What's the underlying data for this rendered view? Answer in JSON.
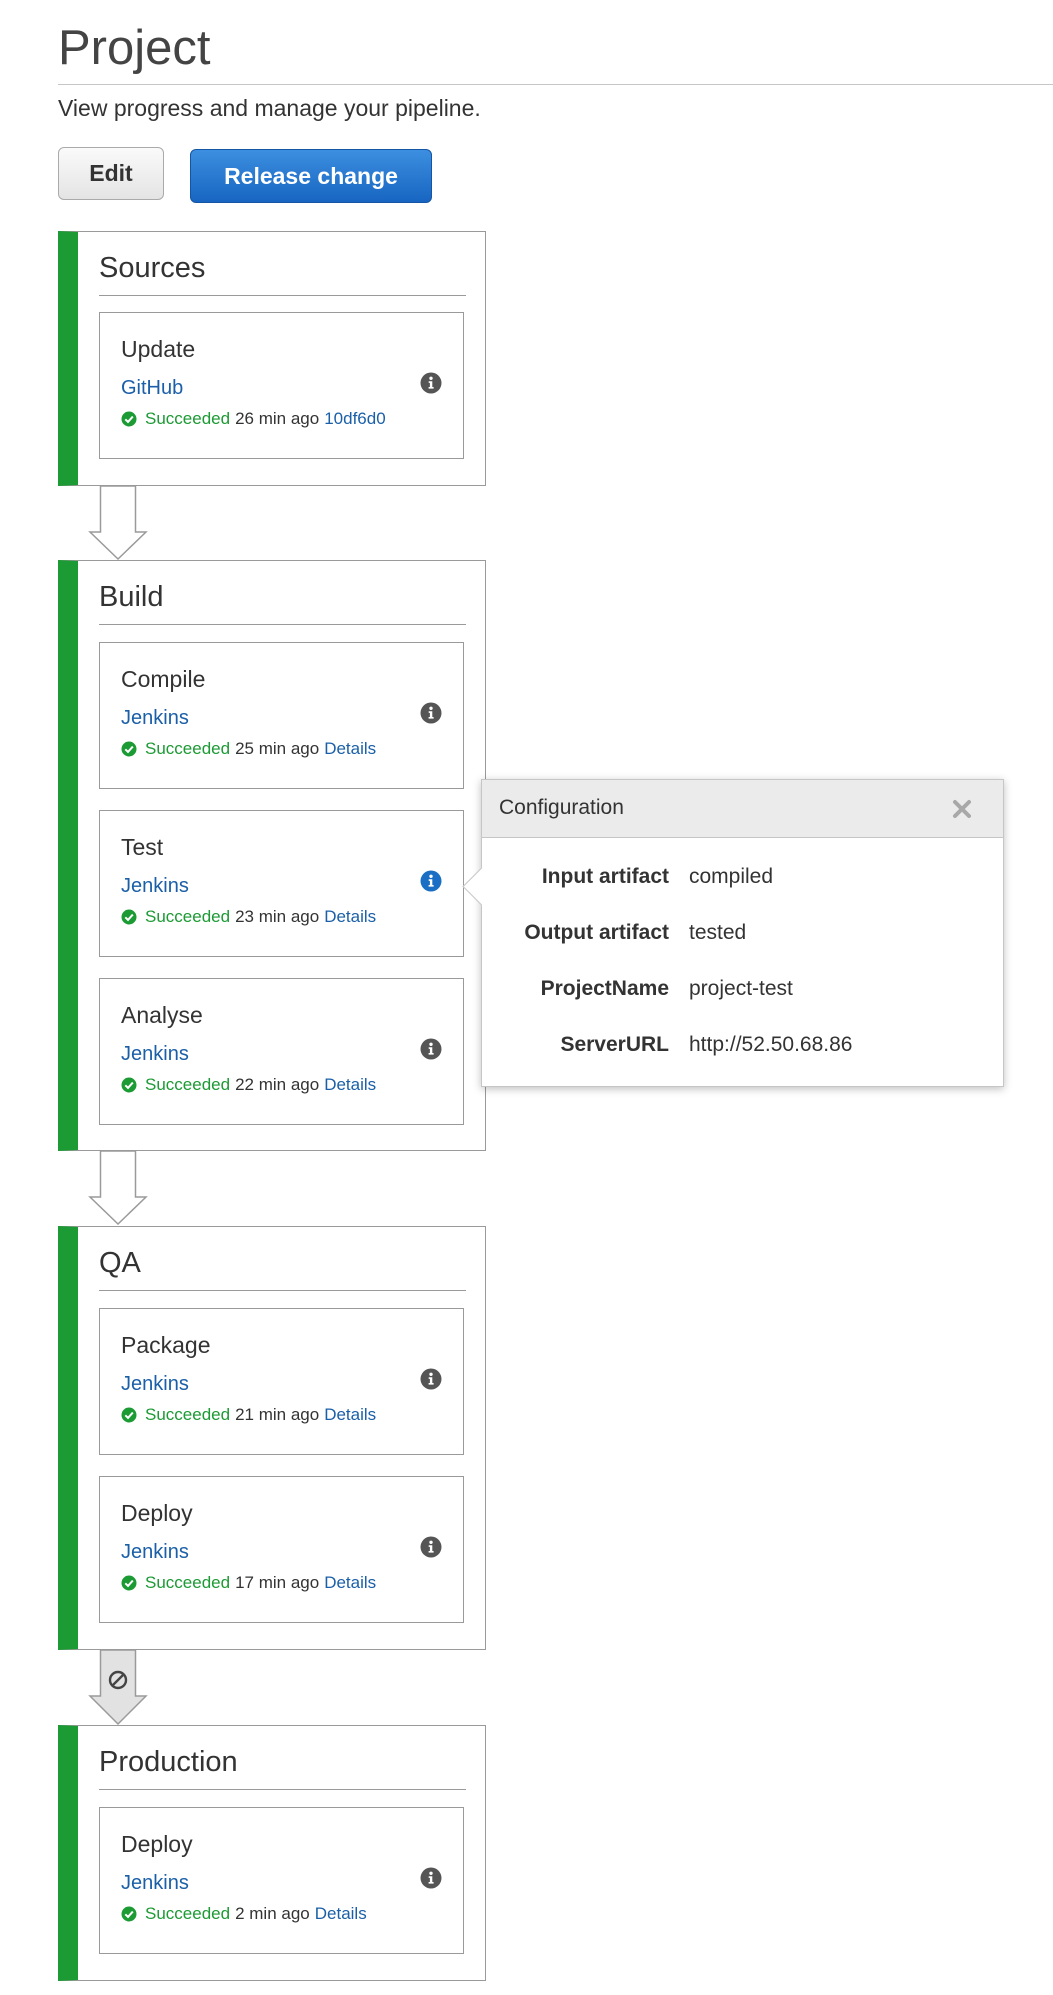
{
  "page": {
    "title": "Project",
    "subtitle": "View progress and manage your pipeline."
  },
  "toolbar": {
    "edit_label": "Edit",
    "release_label": "Release change"
  },
  "colors": {
    "stage_bar": "#1c9a34",
    "succeeded": "#1c9a34",
    "link": "#1a5fa8",
    "primary_button": "#1765c1"
  },
  "stages": [
    {
      "name": "Sources",
      "actions": [
        {
          "name": "Update",
          "provider": "GitHub",
          "status": "Succeeded",
          "time": "26 min ago",
          "link": "10df6d0",
          "icon": "info-icon"
        }
      ]
    },
    {
      "name": "Build",
      "actions": [
        {
          "name": "Compile",
          "provider": "Jenkins",
          "status": "Succeeded",
          "time": "25 min ago",
          "link": "Details",
          "icon": "info-icon"
        },
        {
          "name": "Test",
          "provider": "Jenkins",
          "status": "Succeeded",
          "time": "23 min ago",
          "link": "Details",
          "icon": "info-icon"
        },
        {
          "name": "Analyse",
          "provider": "Jenkins",
          "status": "Succeeded",
          "time": "22 min ago",
          "link": "Details",
          "icon": "info-icon"
        }
      ]
    },
    {
      "name": "QA",
      "actions": [
        {
          "name": "Package",
          "provider": "Jenkins",
          "status": "Succeeded",
          "time": "21 min ago",
          "link": "Details",
          "icon": "info-icon"
        },
        {
          "name": "Deploy",
          "provider": "Jenkins",
          "status": "Succeeded",
          "time": "17 min ago",
          "link": "Details",
          "icon": "info-icon"
        }
      ]
    },
    {
      "name": "Production",
      "actions": [
        {
          "name": "Deploy",
          "provider": "Jenkins",
          "status": "Succeeded",
          "time": "2 min ago",
          "link": "Details",
          "icon": "info-icon"
        }
      ]
    }
  ],
  "transitions": [
    {
      "state": "enabled",
      "icon": "down-arrow-icon"
    },
    {
      "state": "enabled",
      "icon": "down-arrow-icon"
    },
    {
      "state": "disabled",
      "icon": "prohibited-icon"
    }
  ],
  "popover": {
    "title": "Configuration",
    "close_icon": "close-icon",
    "rows": [
      {
        "key": "Input artifact",
        "value": "compiled"
      },
      {
        "key": "Output artifact",
        "value": "tested"
      },
      {
        "key": "ProjectName",
        "value": "project-test"
      },
      {
        "key": "ServerURL",
        "value": "http://52.50.68.86"
      }
    ]
  }
}
